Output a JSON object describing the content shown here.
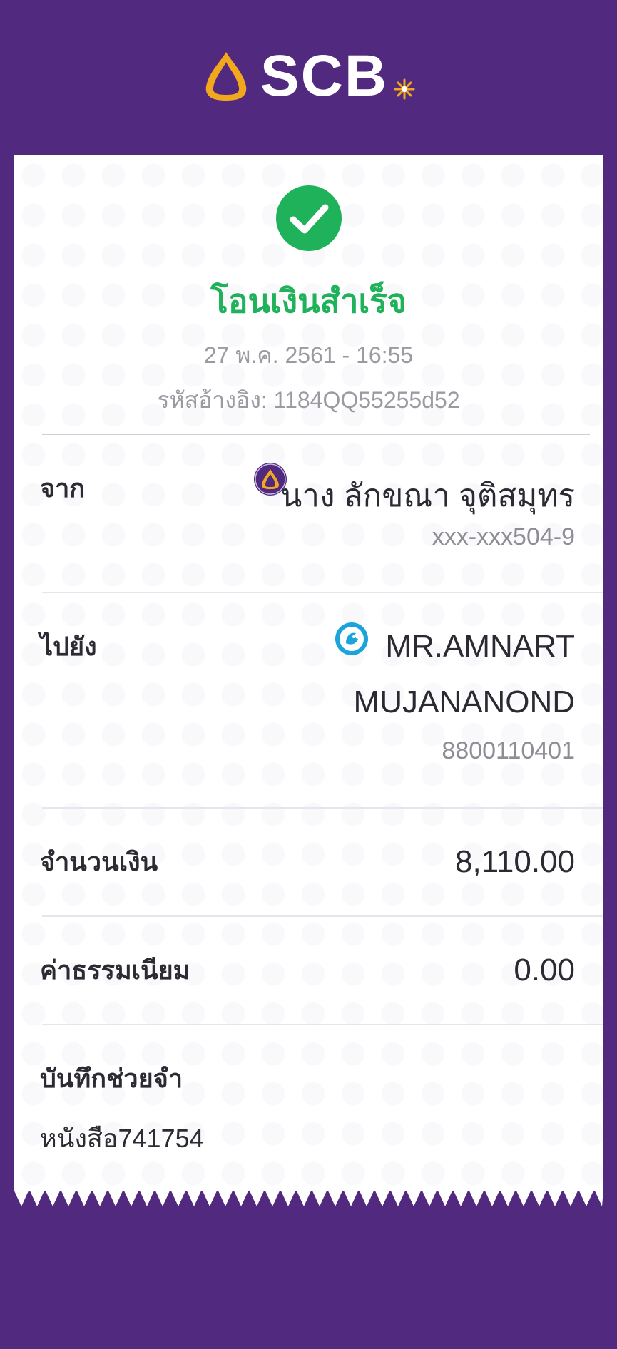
{
  "brand": {
    "name": "SCB",
    "colors": {
      "purple": "#512a80",
      "gold": "#f2a81d",
      "success": "#1fb25a"
    }
  },
  "receipt": {
    "status": "โอนเงินสำเร็จ",
    "datetime": "27 พ.ค. 2561 - 16:55",
    "reference": "รหัสอ้างอิง: 1184QQ55255d52",
    "from": {
      "label": "จาก",
      "name": "นาง ลักขณา จุติสมุทร",
      "account": "xxx-xxx504-9",
      "bank_icon": "scb-icon"
    },
    "to": {
      "label": "ไปยัง",
      "name_line1": "MR.AMNART",
      "name_line2": "MUJANANOND",
      "account": "8800110401",
      "bank_icon": "ktb-icon"
    },
    "amount": {
      "label": "จำนวนเงิน",
      "value": "8,110.00"
    },
    "fee": {
      "label": "ค่าธรรมเนียม",
      "value": "0.00"
    },
    "memo": {
      "label": "บันทึกช่วยจำ",
      "value": "หนังสือ741754"
    }
  }
}
